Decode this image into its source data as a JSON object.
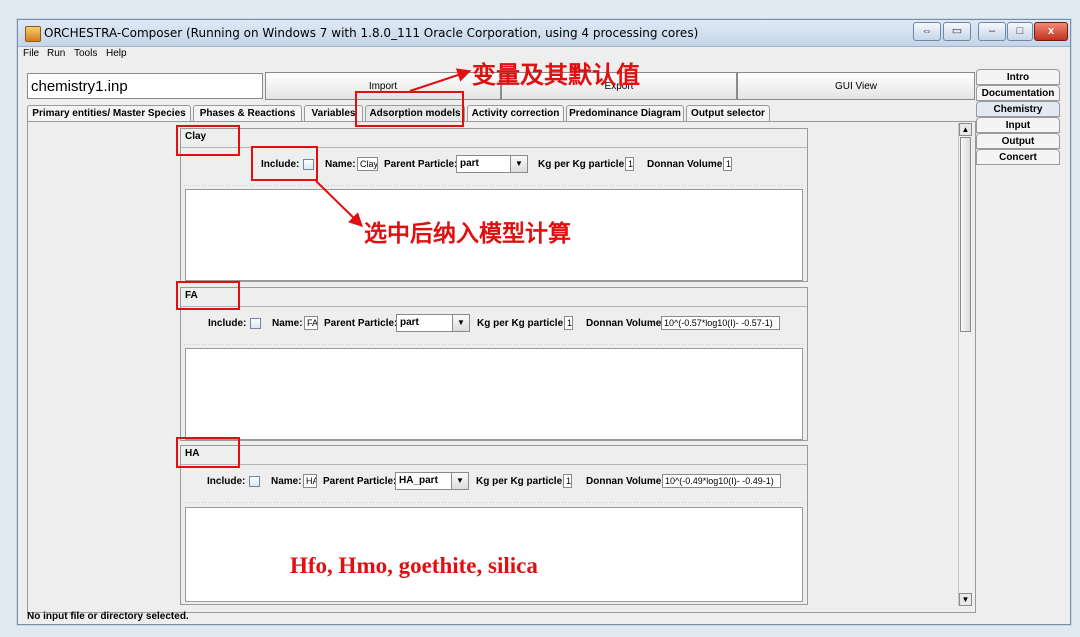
{
  "window": {
    "title": "ORCHESTRA-Composer (Running on Windows 7 with 1.8.0_111  Oracle Corporation, using 4 processing cores)",
    "controls": {
      "restore": "⇔",
      "minimize": "–",
      "maximize": "□",
      "close": "x"
    }
  },
  "menu": [
    "File",
    "Run",
    "Tools",
    "Help"
  ],
  "toolbar": {
    "file_name": "chemistry1.inp",
    "import": "Import",
    "export": "Export",
    "gui_view": "GUI View"
  },
  "side_tabs": [
    "Intro",
    "Documentation",
    "Chemistry",
    "Input",
    "Output",
    "Concert"
  ],
  "tabs": [
    "Primary entities/ Master Species",
    "Phases & Reactions",
    "Variables",
    "Adsorption models",
    "Activity correction",
    "Predominance Diagram",
    "Output selector"
  ],
  "active_tab": "Adsorption models",
  "sections": [
    {
      "title": "Clay",
      "include_label": "Include:",
      "name_label": "Name:",
      "name_value": "Clay",
      "parent_label": "Parent Particle:",
      "parent_value": "part",
      "kg_label": "Kg per Kg particle:",
      "kg_value": "1",
      "donnan_label": "Donnan Volume:",
      "donnan_value": "1"
    },
    {
      "title": "FA",
      "include_label": "Include:",
      "name_label": "Name:",
      "name_value": "FA",
      "parent_label": "Parent Particle:",
      "parent_value": "part",
      "kg_label": "Kg per Kg particle:",
      "kg_value": "1",
      "donnan_label": "Donnan Volume:",
      "donnan_value": "10^(-0.57*log10(I)- -0.57-1)"
    },
    {
      "title": "HA",
      "include_label": "Include:",
      "name_label": "Name:",
      "name_value": "HA",
      "parent_label": "Parent Particle:",
      "parent_value": "HA_part",
      "kg_label": "Kg per Kg particle:",
      "kg_value": "1",
      "donnan_label": "Donnan Volume:",
      "donnan_value": "10^(-0.49*log10(I)- -0.49-1)"
    }
  ],
  "status": "No input file or directory selected.",
  "annotations": {
    "variables_default": "变量及其默认值",
    "include_note": "选中后纳入模型计算",
    "other_models": "Hfo, Hmo, goethite, silica"
  },
  "colors": {
    "annotation": "#e01010"
  }
}
